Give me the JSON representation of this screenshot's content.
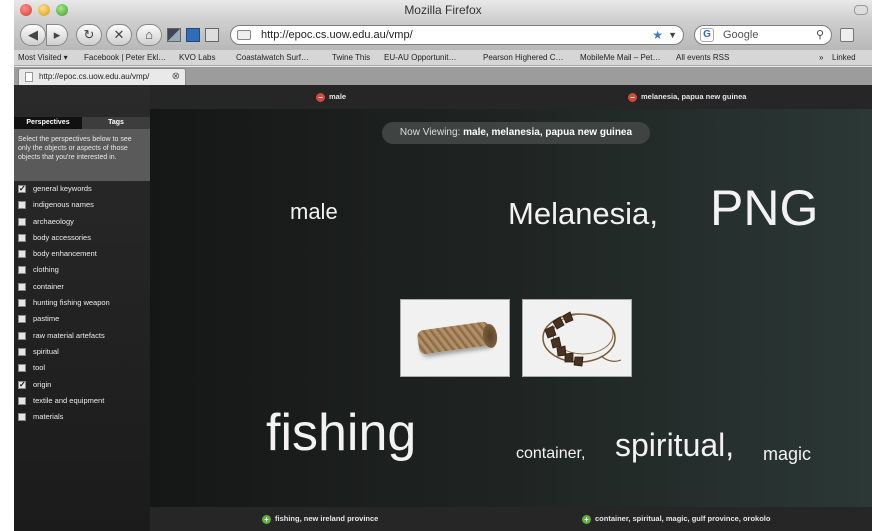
{
  "window": {
    "title": "Mozilla Firefox"
  },
  "toolbar": {
    "url": "http://epoc.cs.uow.edu.au/vmp/",
    "search_placeholder": "Google"
  },
  "bookmarks": [
    "Most Visited ▾",
    "Facebook | Peter Ekl…",
    "KVO Labs ⁠ ⁠",
    "Coastalwatch Surf… ⁠",
    "Twine This",
    "EU-AU Opportunit… ⁠",
    "Pearson Highered C…",
    "MobileMe Mail – Pet…",
    "All events RSS",
    "Linked"
  ],
  "tab": {
    "label": "http://epoc.cs.uow.edu.au/vmp/"
  },
  "sidebar": {
    "tab_perspectives": "Perspectives",
    "tab_tags": "Tags",
    "instructions": "Select the perspectives below to see only the objects or aspects of those objects that you're interested in.",
    "items": [
      {
        "label": "general keywords",
        "checked": true
      },
      {
        "label": "indigenous names",
        "checked": false
      },
      {
        "label": "archaeology",
        "checked": false
      },
      {
        "label": "body accessories",
        "checked": false
      },
      {
        "label": "body enhancement",
        "checked": false
      },
      {
        "label": "clothing",
        "checked": false
      },
      {
        "label": "container",
        "checked": false
      },
      {
        "label": "hunting fishing weapon",
        "checked": false
      },
      {
        "label": "pastime",
        "checked": false
      },
      {
        "label": "raw material artefacts",
        "checked": false
      },
      {
        "label": "spiritual",
        "checked": false
      },
      {
        "label": "tool",
        "checked": false
      },
      {
        "label": "origin",
        "checked": true
      },
      {
        "label": "textile and equipment",
        "checked": false
      },
      {
        "label": "materials",
        "checked": false
      }
    ]
  },
  "main": {
    "top_filters": [
      "male",
      "melanesia, papua new guinea"
    ],
    "bottom_filters": [
      "fishing, new ireland province",
      "container, spiritual, magic, gulf province, orokolo"
    ],
    "now_viewing_label": "Now Viewing:",
    "now_viewing_value": "male, melanesia, papua new guinea",
    "tags": {
      "male": "male",
      "melanesia": "Melanesia",
      "png": "PNG",
      "fishing": "fishing",
      "container": "container",
      "spiritual": "spiritual",
      "magic": "magic"
    },
    "separator": ","
  },
  "colors": {
    "remove_dot": "#d24a3c",
    "add_dot": "#5fae3e",
    "bar_bg": "#262626"
  }
}
